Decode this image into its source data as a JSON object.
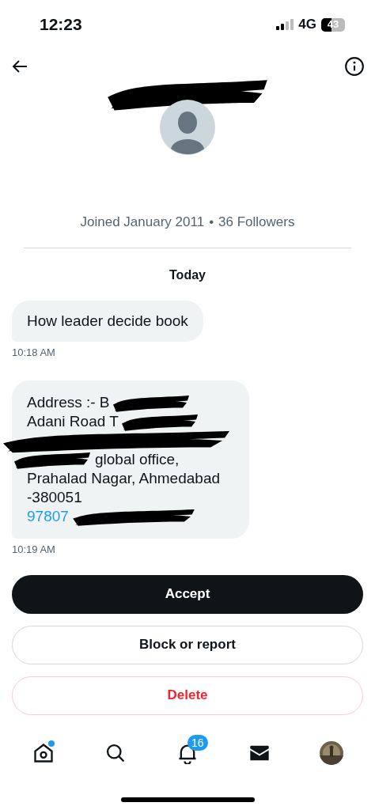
{
  "status_bar": {
    "time": "12:23",
    "network": "4G",
    "battery": "43"
  },
  "header": {
    "name_redacted": true
  },
  "profile": {
    "joined": "Joined January 2011",
    "separator": "•",
    "followers": "36 Followers"
  },
  "day_label": "Today",
  "messages": [
    {
      "lines": [
        {
          "kind": "text",
          "text": "How leader decide book"
        }
      ],
      "time": "10:18 AM"
    },
    {
      "lines": [
        {
          "kind": "text",
          "text": "Address :- B",
          "hidden_after": true
        },
        {
          "kind": "text",
          "text": "Adani Road T",
          "hidden_after": true
        },
        {
          "kind": "hidden"
        },
        {
          "kind": "text",
          "text": "global office,",
          "hidden_before": true
        },
        {
          "kind": "text",
          "text": "Prahalad Nagar, Ahmedabad"
        },
        {
          "kind": "text",
          "text": "-380051"
        },
        {
          "kind": "link",
          "text": "97807",
          "hidden_after": true
        }
      ],
      "time": "10:19 AM"
    }
  ],
  "actions": [
    {
      "kind": "primary",
      "label": "Accept"
    },
    {
      "kind": "secondary",
      "label": "Block or report"
    },
    {
      "kind": "danger",
      "label": "Delete"
    }
  ],
  "tab_bar": [
    {
      "kind": "home",
      "dot": true
    },
    {
      "kind": "search"
    },
    {
      "kind": "notifications",
      "badge": "16"
    },
    {
      "kind": "messages"
    },
    {
      "kind": "profile"
    }
  ]
}
